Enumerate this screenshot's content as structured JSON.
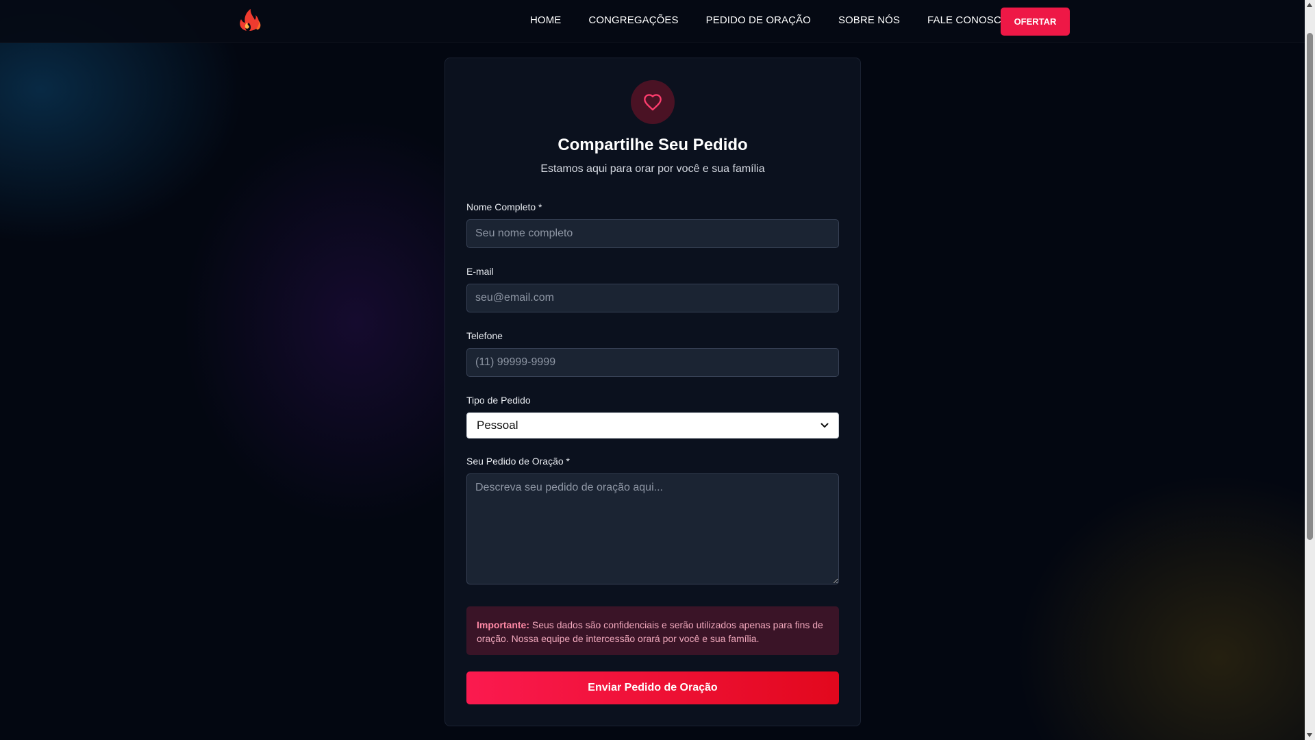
{
  "nav": {
    "logo_icon": "flame-icon",
    "links": [
      "HOME",
      "CONGREGAÇÕES",
      "PEDIDO DE ORAÇÃO",
      "SOBRE NÓS",
      "FALE CONOSCO"
    ],
    "cta_label": "OFERTAR"
  },
  "form": {
    "icon": "heart-icon",
    "title": "Compartilhe Seu Pedido",
    "subtitle": "Estamos aqui para orar por você e sua família",
    "name_label": "Nome Completo *",
    "name_placeholder": "Seu nome completo",
    "email_label": "E-mail",
    "email_placeholder": "seu@email.com",
    "phone_label": "Telefone",
    "phone_placeholder": "(11) 99999-9999",
    "type_label": "Tipo de Pedido",
    "type_value": "Pessoal",
    "request_label": "Seu Pedido de Oração *",
    "request_placeholder": "Descreva seu pedido de oração aqui...",
    "notice_bold": "Importante:",
    "notice_text": "Seus dados são confidenciais e serão utilizados apenas para fins de oração. Nossa equipe de intercessão orará por você e sua família.",
    "submit_label": "Enviar Pedido de Oração"
  },
  "colors": {
    "accent": "#ee1846",
    "background": "#030711",
    "card": "#0b111e"
  }
}
